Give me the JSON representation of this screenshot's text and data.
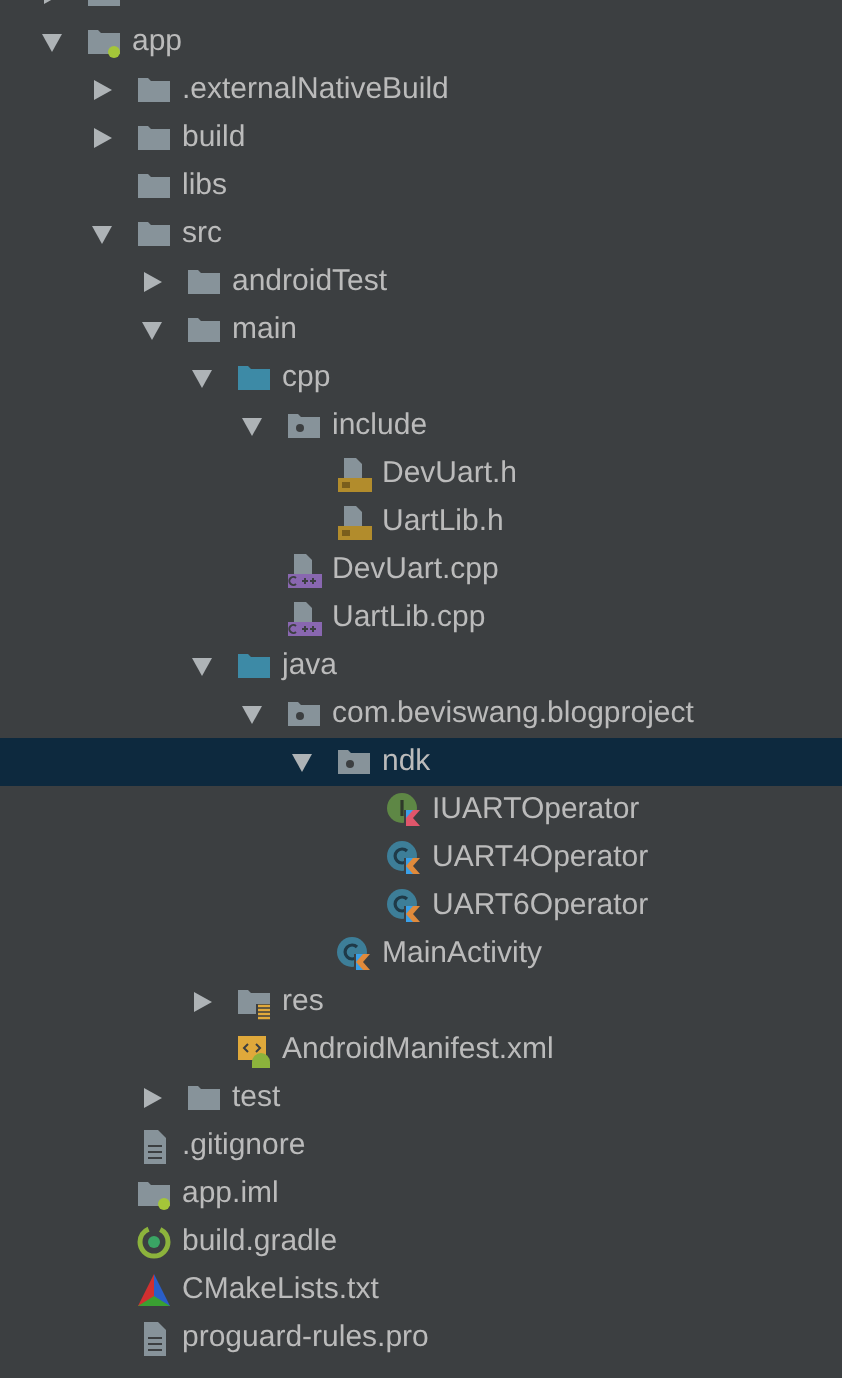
{
  "tree": [
    {
      "kind": "folder",
      "expanded": false,
      "selected": false
    },
    {
      "label": "app",
      "kind": "module",
      "expanded": true,
      "selected": false,
      "children": [
        {
          "label": ".externalNativeBuild",
          "kind": "folder",
          "expanded": false,
          "selected": false
        },
        {
          "label": "build",
          "kind": "folder",
          "expanded": false,
          "selected": false
        },
        {
          "label": "libs",
          "kind": "folder",
          "selected": false
        },
        {
          "label": "src",
          "kind": "folder",
          "expanded": true,
          "selected": false,
          "children": [
            {
              "label": "androidTest",
              "kind": "folder",
              "expanded": false,
              "selected": false
            },
            {
              "label": "main",
              "kind": "folder",
              "expanded": true,
              "selected": false,
              "children": [
                {
                  "label": "cpp",
                  "kind": "source",
                  "expanded": true,
                  "selected": false,
                  "children": [
                    {
                      "label": "include",
                      "kind": "package",
                      "expanded": true,
                      "selected": false,
                      "children": [
                        {
                          "label": "DevUart.h",
                          "kind": "header",
                          "selected": false
                        },
                        {
                          "label": "UartLib.h",
                          "kind": "header",
                          "selected": false
                        }
                      ]
                    },
                    {
                      "label": "DevUart.cpp",
                      "kind": "cpp",
                      "selected": false
                    },
                    {
                      "label": "UartLib.cpp",
                      "kind": "cpp",
                      "selected": false
                    }
                  ]
                },
                {
                  "label": "java",
                  "kind": "source",
                  "expanded": true,
                  "selected": false,
                  "children": [
                    {
                      "label": "com.beviswang.blogproject",
                      "kind": "package",
                      "expanded": true,
                      "selected": false,
                      "children": [
                        {
                          "label": "ndk",
                          "kind": "package",
                          "expanded": true,
                          "selected": true,
                          "children": [
                            {
                              "label": "IUARTOperator",
                              "kind": "interface",
                              "selected": false
                            },
                            {
                              "label": "UART4Operator",
                              "kind": "class",
                              "selected": false
                            },
                            {
                              "label": "UART6Operator",
                              "kind": "class",
                              "selected": false
                            }
                          ]
                        },
                        {
                          "label": "MainActivity",
                          "kind": "class",
                          "selected": false
                        }
                      ]
                    }
                  ]
                },
                {
                  "label": "res",
                  "kind": "res",
                  "expanded": false,
                  "selected": false
                },
                {
                  "label": "AndroidManifest.xml",
                  "kind": "manifest",
                  "selected": false
                }
              ]
            },
            {
              "label": "test",
              "kind": "folder",
              "expanded": false,
              "selected": false
            }
          ]
        },
        {
          "label": ".gitignore",
          "kind": "file",
          "selected": false
        },
        {
          "label": "app.iml",
          "kind": "iml",
          "selected": false
        },
        {
          "label": "build.gradle",
          "kind": "gradle",
          "selected": false
        },
        {
          "label": "CMakeLists.txt",
          "kind": "cmake",
          "selected": false
        },
        {
          "label": "proguard-rules.pro",
          "kind": "file",
          "selected": false
        }
      ]
    }
  ]
}
